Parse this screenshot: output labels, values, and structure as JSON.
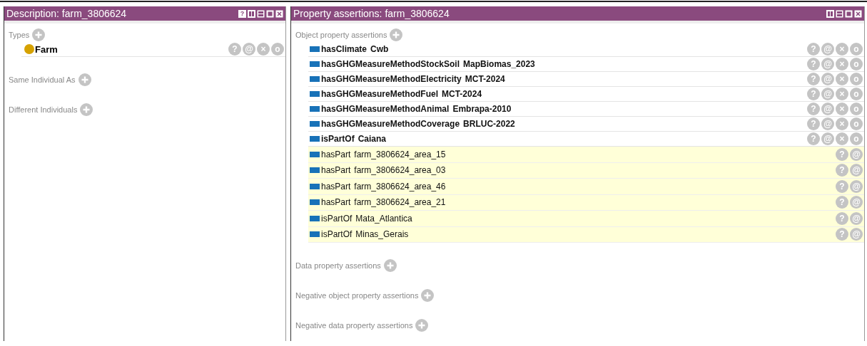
{
  "description_panel": {
    "title": "Description: farm_3806624",
    "header_buttons": [
      {
        "kind": "help",
        "label": "?"
      },
      {
        "kind": "split-vertical"
      },
      {
        "kind": "split-horizontal"
      },
      {
        "kind": "maximize"
      },
      {
        "kind": "close"
      }
    ],
    "sections": [
      {
        "label": "Types",
        "items": [
          {
            "name": "Farm",
            "buttons": [
              "?",
              "@",
              "×",
              "o"
            ]
          }
        ]
      },
      {
        "label": "Same Individual As"
      },
      {
        "label": "Different Individuals"
      }
    ]
  },
  "property_panel": {
    "title": "Property assertions: farm_3806624",
    "header_buttons": [
      {
        "kind": "split-vertical"
      },
      {
        "kind": "split-horizontal"
      },
      {
        "kind": "maximize"
      },
      {
        "kind": "close"
      }
    ],
    "sections": [
      {
        "label": "Object property assertions",
        "items": [
          {
            "property": "hasClimate",
            "value": "Cwb",
            "inferred": false,
            "buttons": [
              "?",
              "@",
              "×",
              "o"
            ]
          },
          {
            "property": "hasGHGMeasureMethodStockSoil",
            "value": "MapBiomas_2023",
            "inferred": false,
            "buttons": [
              "?",
              "@",
              "×",
              "o"
            ]
          },
          {
            "property": "hasGHGMeasureMethodElectricity",
            "value": "MCT-2024",
            "inferred": false,
            "buttons": [
              "?",
              "@",
              "×",
              "o"
            ]
          },
          {
            "property": "hasGHGMeasureMethodFuel",
            "value": "MCT-2024",
            "inferred": false,
            "buttons": [
              "?",
              "@",
              "×",
              "o"
            ]
          },
          {
            "property": "hasGHGMeasureMethodAnimal",
            "value": "Embrapa-2010",
            "inferred": false,
            "buttons": [
              "?",
              "@",
              "×",
              "o"
            ]
          },
          {
            "property": "hasGHGMeasureMethodCoverage",
            "value": "BRLUC-2022",
            "inferred": false,
            "buttons": [
              "?",
              "@",
              "×",
              "o"
            ]
          },
          {
            "property": "isPartOf",
            "value": "Caiana",
            "inferred": false,
            "buttons": [
              "?",
              "@",
              "×",
              "o"
            ]
          },
          {
            "property": "hasPart",
            "value": "farm_3806624_area_15",
            "inferred": true,
            "buttons": [
              "?",
              "@"
            ]
          },
          {
            "property": "hasPart",
            "value": "farm_3806624_area_03",
            "inferred": true,
            "buttons": [
              "?",
              "@"
            ]
          },
          {
            "property": "hasPart",
            "value": "farm_3806624_area_46",
            "inferred": true,
            "buttons": [
              "?",
              "@"
            ]
          },
          {
            "property": "hasPart",
            "value": "farm_3806624_area_21",
            "inferred": true,
            "buttons": [
              "?",
              "@"
            ]
          },
          {
            "property": "isPartOf",
            "value": "Mata_Atlantica",
            "inferred": true,
            "buttons": [
              "?",
              "@"
            ]
          },
          {
            "property": "isPartOf",
            "value": "Minas_Gerais",
            "inferred": true,
            "buttons": [
              "?",
              "@"
            ]
          }
        ]
      },
      {
        "label": "Data property assertions"
      },
      {
        "label": "Negative object property assertions"
      },
      {
        "label": "Negative data property assertions"
      }
    ]
  }
}
